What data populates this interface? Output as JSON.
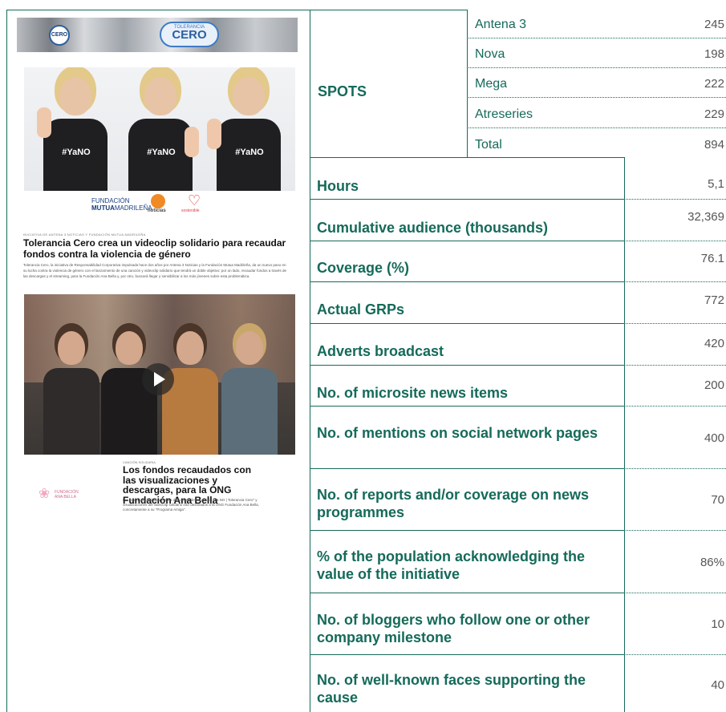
{
  "left_panel": {
    "banner": {
      "logo_small": "CERO",
      "logo_pill_small": "TOLERANCIA",
      "logo_pill_big": "CERO"
    },
    "photo1_shirts": [
      "#YaNO",
      "#YaNO",
      "#YaNO"
    ],
    "sponsors": {
      "fundacion_line1": "FUNDACIÓN",
      "fundacion_line2_bold": "MUTUA",
      "fundacion_line2_rest": "MADRILEÑA",
      "noticias": "noticias",
      "third": "sostenible"
    },
    "article1": {
      "kicker": "INICIATIVA DE ANTENA 3 NOTICIAS Y FUNDACIÓN MUTUA MADRILEÑA",
      "headline": "Tolerancia Cero crea un videoclip solidario para recaudar fondos contra la violencia de género",
      "body": "Tolerancia Cero, la iniciativa de Responsabilidad Corporativa impulsada hace dos años por Antena 3 Noticias y la Fundación Mutua Madrileña, da un nuevo paso en su lucha contra la violencia de género con el lanzamiento de una canción y videoclip solidario que tendrá un doble objetivo: por un lado, recaudar fondos a través de las descargas y el streaming, para la Fundación Ana Bella y, por otro, buscará llegar y sensibilizar a los más jóvenes sobre esta problemática."
    },
    "article2": {
      "kicker": "CANCIÓN SOLIDARIA",
      "headline": "Los fondos recaudados con las visualizaciones y descargas, para la ONG Fundación Ana Bella",
      "body": "Los fondos recaudados por las descargas de la canción \"Ya NO | Tolerancia Cero\" y visualizaciones del videoclip solidario irán destinados a la ONG Fundación Ana Bella, concretamente a su \"Programa Amiga\".",
      "logo_text_1": "FUNDACIÓN",
      "logo_text_2": "ANA BELLA"
    }
  },
  "table": {
    "spots_label": "SPOTS",
    "spots": [
      {
        "channel": "Antena 3",
        "value": "245"
      },
      {
        "channel": "Nova",
        "value": "198"
      },
      {
        "channel": "Mega",
        "value": "222"
      },
      {
        "channel": "Atreseries",
        "value": "229"
      },
      {
        "channel": "Total",
        "value": "894"
      }
    ],
    "rows": [
      {
        "label": "Hours",
        "value": "5,1"
      },
      {
        "label": "Cumulative audience (thousands)",
        "value": "32,369"
      },
      {
        "label": "Coverage (%)",
        "value": "76.1"
      },
      {
        "label": "Actual GRPs",
        "value": "772"
      },
      {
        "label": "Adverts broadcast",
        "value": "420"
      },
      {
        "label": "No. of microsite news items",
        "value": "200"
      },
      {
        "label": "No. of mentions on social network pages",
        "value": "400"
      },
      {
        "label": "No. of reports and/or coverage on news programmes",
        "value": "70"
      },
      {
        "label": "% of the population acknowledging the value of the initiative",
        "value": "86%"
      },
      {
        "label": "No. of bloggers who follow one or other company milestone",
        "value": "10"
      },
      {
        "label": "No. of well-known faces supporting the cause",
        "value": "40"
      }
    ]
  },
  "colors": {
    "accent": "#156a5a",
    "number": "#555555"
  }
}
